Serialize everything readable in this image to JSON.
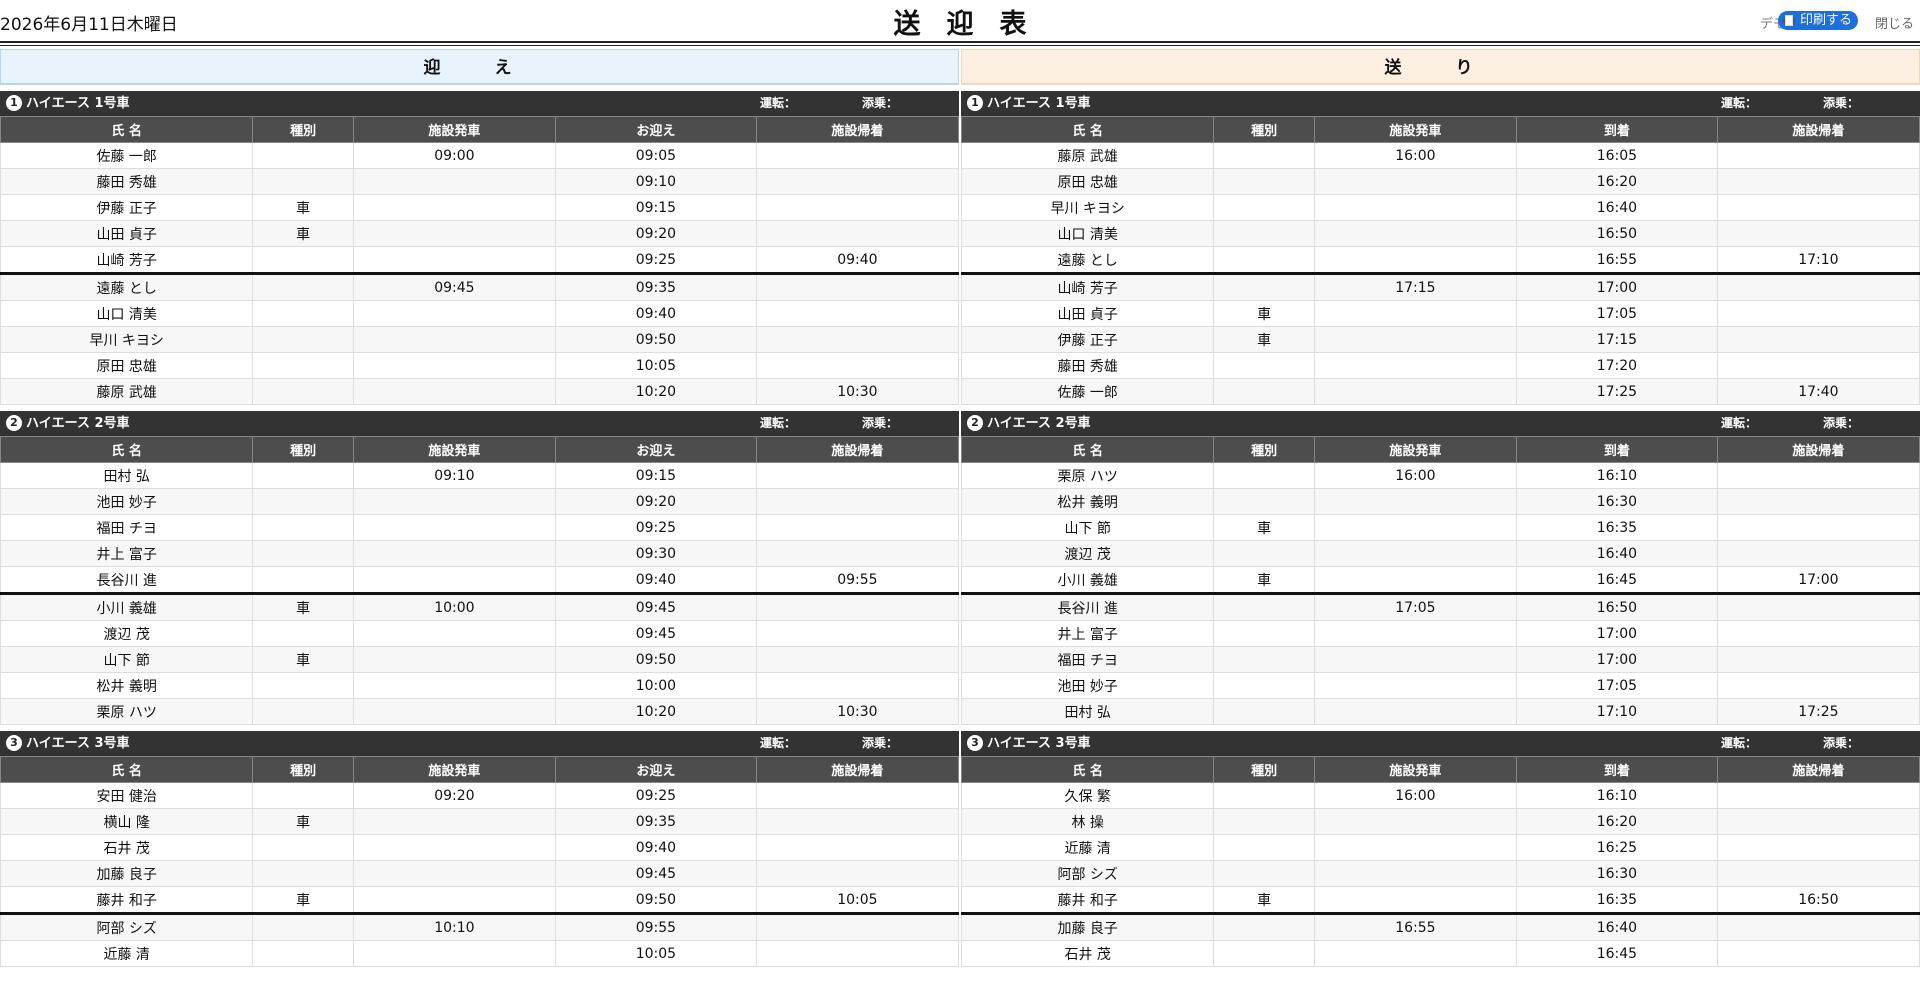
{
  "header": {
    "date": "2026年6月11日木曜日",
    "title": "送迎表",
    "behind_text": "デモ",
    "print_label": "印刷する",
    "close_label": "閉じる",
    "print_button_color": "#1e6fd9"
  },
  "columns": {
    "head_name": "氏 名",
    "head_type": "種別",
    "head_depart": "施設発車",
    "head_return": "施設帰着",
    "driver_label": "運転：",
    "helper_label": "添乗："
  },
  "pickup": {
    "label": "迎 え",
    "time_header": "お迎え",
    "cars": [
      {
        "num": "1",
        "name": "ハイエース 1号車",
        "rows": [
          [
            "佐藤 一郎",
            "",
            "09:00",
            "09:05",
            ""
          ],
          [
            "藤田 秀雄",
            "",
            "",
            "09:10",
            ""
          ],
          [
            "伊藤 正子",
            "車",
            "",
            "09:15",
            ""
          ],
          [
            "山田 貞子",
            "車",
            "",
            "09:20",
            ""
          ],
          [
            "山崎 芳子",
            "",
            "",
            "09:25",
            "09:40"
          ],
          [
            "遠藤 とし",
            "",
            "09:45",
            "09:35",
            ""
          ],
          [
            "山口 清美",
            "",
            "",
            "09:40",
            ""
          ],
          [
            "早川 キヨシ",
            "",
            "",
            "09:50",
            ""
          ],
          [
            "原田 忠雄",
            "",
            "",
            "10:05",
            ""
          ],
          [
            "藤原 武雄",
            "",
            "",
            "10:20",
            "10:30"
          ]
        ]
      },
      {
        "num": "2",
        "name": "ハイエース 2号車",
        "rows": [
          [
            "田村 弘",
            "",
            "09:10",
            "09:15",
            ""
          ],
          [
            "池田 妙子",
            "",
            "",
            "09:20",
            ""
          ],
          [
            "福田 チヨ",
            "",
            "",
            "09:25",
            ""
          ],
          [
            "井上 富子",
            "",
            "",
            "09:30",
            ""
          ],
          [
            "長谷川 進",
            "",
            "",
            "09:40",
            "09:55"
          ],
          [
            "小川 義雄",
            "車",
            "10:00",
            "09:45",
            ""
          ],
          [
            "渡辺 茂",
            "",
            "",
            "09:45",
            ""
          ],
          [
            "山下 節",
            "車",
            "",
            "09:50",
            ""
          ],
          [
            "松井 義明",
            "",
            "",
            "10:00",
            ""
          ],
          [
            "栗原 ハツ",
            "",
            "",
            "10:20",
            "10:30"
          ]
        ]
      },
      {
        "num": "3",
        "name": "ハイエース 3号車",
        "rows": [
          [
            "安田 健治",
            "",
            "09:20",
            "09:25",
            ""
          ],
          [
            "横山 隆",
            "車",
            "",
            "09:35",
            ""
          ],
          [
            "石井 茂",
            "",
            "",
            "09:40",
            ""
          ],
          [
            "加藤 良子",
            "",
            "",
            "09:45",
            ""
          ],
          [
            "藤井 和子",
            "車",
            "",
            "09:50",
            "10:05"
          ],
          [
            "阿部 シズ",
            "",
            "10:10",
            "09:55",
            ""
          ],
          [
            "近藤 清",
            "",
            "",
            "10:05",
            ""
          ]
        ]
      }
    ]
  },
  "dropoff": {
    "label": "送 り",
    "time_header": "到着",
    "cars": [
      {
        "num": "1",
        "name": "ハイエース 1号車",
        "rows": [
          [
            "藤原 武雄",
            "",
            "16:00",
            "16:05",
            ""
          ],
          [
            "原田 忠雄",
            "",
            "",
            "16:20",
            ""
          ],
          [
            "早川 キヨシ",
            "",
            "",
            "16:40",
            ""
          ],
          [
            "山口 清美",
            "",
            "",
            "16:50",
            ""
          ],
          [
            "遠藤 とし",
            "",
            "",
            "16:55",
            "17:10"
          ],
          [
            "山崎 芳子",
            "",
            "17:15",
            "17:00",
            ""
          ],
          [
            "山田 貞子",
            "車",
            "",
            "17:05",
            ""
          ],
          [
            "伊藤 正子",
            "車",
            "",
            "17:15",
            ""
          ],
          [
            "藤田 秀雄",
            "",
            "",
            "17:20",
            ""
          ],
          [
            "佐藤 一郎",
            "",
            "",
            "17:25",
            "17:40"
          ]
        ]
      },
      {
        "num": "2",
        "name": "ハイエース 2号車",
        "rows": [
          [
            "栗原 ハツ",
            "",
            "16:00",
            "16:10",
            ""
          ],
          [
            "松井 義明",
            "",
            "",
            "16:30",
            ""
          ],
          [
            "山下 節",
            "車",
            "",
            "16:35",
            ""
          ],
          [
            "渡辺 茂",
            "",
            "",
            "16:40",
            ""
          ],
          [
            "小川 義雄",
            "車",
            "",
            "16:45",
            "17:00"
          ],
          [
            "長谷川 進",
            "",
            "17:05",
            "16:50",
            ""
          ],
          [
            "井上 富子",
            "",
            "",
            "17:00",
            ""
          ],
          [
            "福田 チヨ",
            "",
            "",
            "17:00",
            ""
          ],
          [
            "池田 妙子",
            "",
            "",
            "17:05",
            ""
          ],
          [
            "田村 弘",
            "",
            "",
            "17:10",
            "17:25"
          ]
        ]
      },
      {
        "num": "3",
        "name": "ハイエース 3号車",
        "rows": [
          [
            "久保 繁",
            "",
            "16:00",
            "16:10",
            ""
          ],
          [
            "林 操",
            "",
            "",
            "16:20",
            ""
          ],
          [
            "近藤 清",
            "",
            "",
            "16:25",
            ""
          ],
          [
            "阿部 シズ",
            "",
            "",
            "16:30",
            ""
          ],
          [
            "藤井 和子",
            "車",
            "",
            "16:35",
            "16:50"
          ],
          [
            "加藤 良子",
            "",
            "16:55",
            "16:40",
            ""
          ],
          [
            "石井 茂",
            "",
            "",
            "16:45",
            ""
          ]
        ]
      }
    ]
  }
}
